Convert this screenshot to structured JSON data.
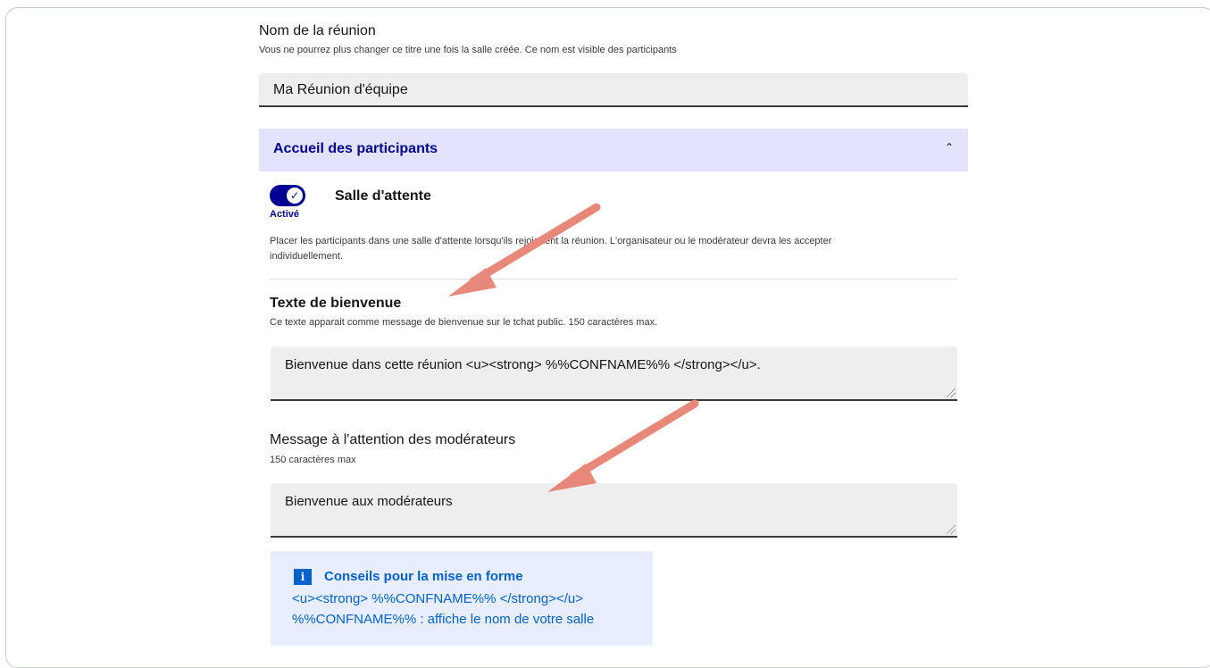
{
  "meeting_name": {
    "label": "Nom de la réunion",
    "hint": "Vous ne pourrez plus changer ce titre une fois la salle créée. Ce nom est visible des participants",
    "value": "Ma Réunion d'équipe"
  },
  "accordion": {
    "title": "Accueil des participants",
    "chevron": "⌃",
    "expanded": true
  },
  "waiting_room": {
    "label": "Salle d'attente",
    "toggle_on": true,
    "toggle_check": "✓",
    "status": "Activé",
    "description_line1": "Placer les participants dans une salle d'attente lorsqu'ils rejoignent la réunion. L'organisateur ou le modérateur devra les accepter",
    "description_line2": "individuellement."
  },
  "welcome_text": {
    "label": "Texte de bienvenue",
    "hint": "Ce texte apparait comme message de bienvenue sur le tchat public. 150 caractères max.",
    "value": "Bienvenue dans cette réunion <u><strong> %%CONFNAME%% </strong></u>."
  },
  "moderator_message": {
    "label": "Message à l'attention des modérateurs",
    "hint": "150 caractères max",
    "value": "Bienvenue aux modérateurs"
  },
  "tips": {
    "icon": "i",
    "title": "Conseils pour la mise en forme",
    "line1": "<u><strong> %%CONFNAME%% </strong></u>",
    "line2": "%%CONFNAME%% : affiche le nom de votre salle"
  },
  "colors": {
    "primary_blue": "#000091",
    "info_blue": "#0063cb",
    "accordion_bg": "#e3e3fd",
    "tips_bg": "#e8edff",
    "annotation_arrow": "#e8887a"
  }
}
